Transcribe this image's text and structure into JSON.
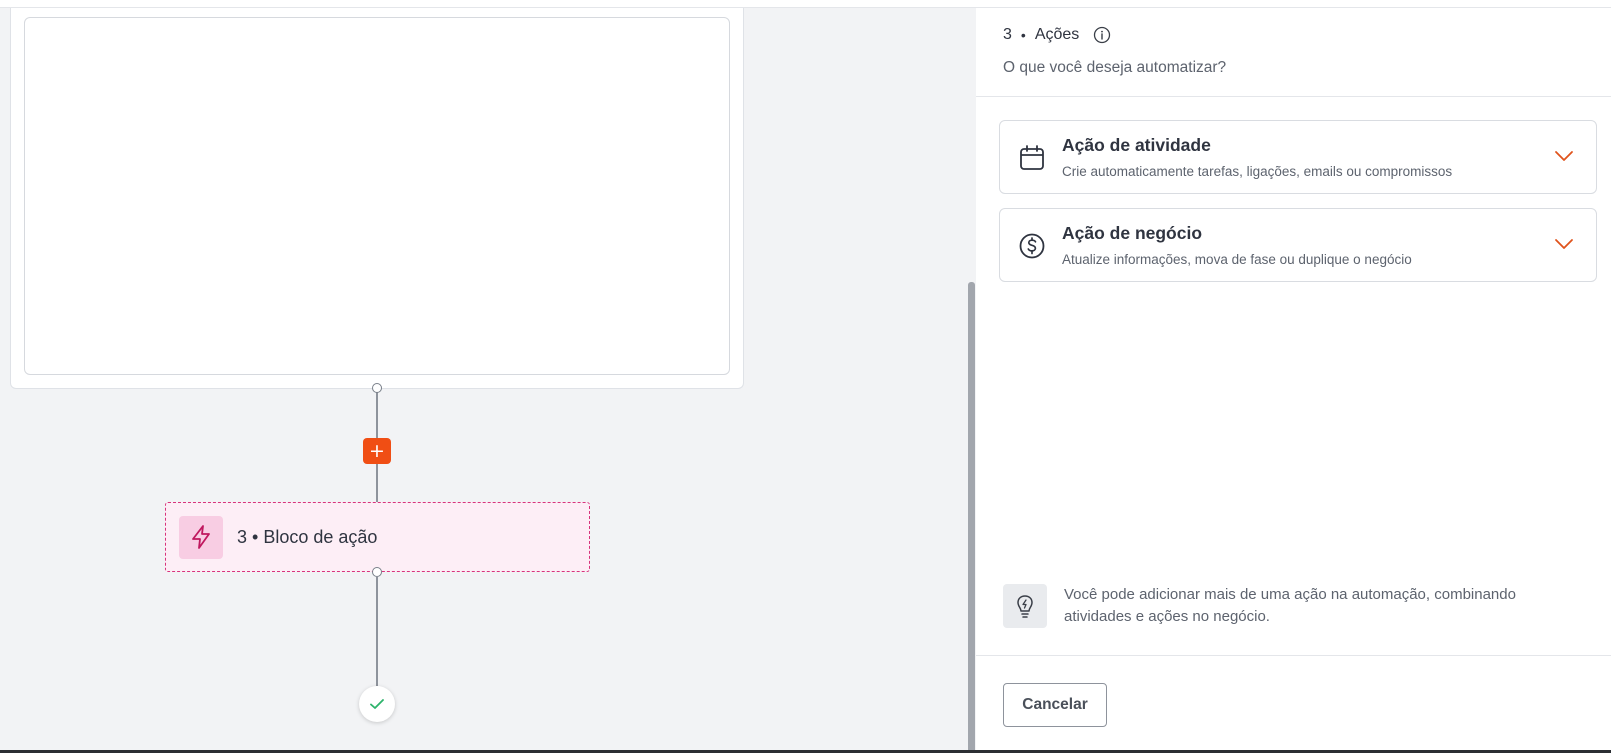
{
  "canvas": {
    "action_block": {
      "title": "3 • Bloco de ação",
      "icon": "lightning-icon"
    },
    "add_step_label": "+",
    "end_node_icon": "checkmark-icon"
  },
  "panel": {
    "header": {
      "step_number": "3",
      "separator": "•",
      "title": "Ações",
      "info_icon": "info-icon",
      "subtitle": "O que você deseja automatizar?"
    },
    "options": [
      {
        "title": "Ação de atividade",
        "description": "Crie automaticamente tarefas, ligações, emails ou compromissos",
        "icon": "calendar-icon"
      },
      {
        "title": "Ação de negócio",
        "description": "Atualize informações, mova de fase ou duplique o negócio",
        "icon": "dollar-circle-icon"
      }
    ],
    "tip": {
      "icon": "lightbulb-icon",
      "text": "Você pode adicionar mais de uma ação na automação, combinando atividades e ações no negócio."
    },
    "footer": {
      "cancel_label": "Cancelar"
    }
  },
  "colors": {
    "accent_orange": "#f04e14",
    "action_pink_border": "#d8337c",
    "action_pink_bg": "#fdeef6",
    "success_green": "#2db36b"
  }
}
